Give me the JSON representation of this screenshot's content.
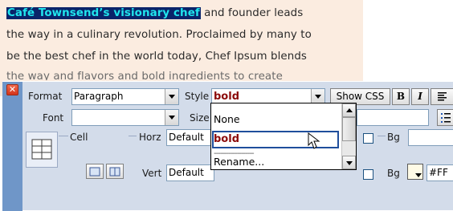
{
  "document": {
    "line1_selected": "Café Townsend’s visionary chef",
    "line1_rest": " and founder leads",
    "line2": "the way in a culinary revolution. Proclaimed by many to",
    "line3": "be the best chef in the world today, Chef Ipsum blends"
  },
  "inspector": {
    "close_icon": "close-icon",
    "format_label": "Format",
    "format_value": "Paragraph",
    "style_label": "Style",
    "style_value": "bold",
    "show_css_label": "Show CSS",
    "bold_label": "B",
    "italic_label": "I",
    "font_label": "Font",
    "font_value": "",
    "size_label": "Size",
    "cell_label": "Cell",
    "horz_label": "Horz",
    "horz_value": "Default",
    "vert_label": "Vert",
    "vert_value": "Default",
    "bg_label_1": "Bg",
    "bg_label_2": "Bg",
    "bg_color_value": "#FF",
    "style_menu": {
      "items": [
        "None",
        "bold",
        "-------------------",
        "Rename..."
      ],
      "selected": "bold"
    }
  },
  "colors": {
    "selection_bg": "#0a246a",
    "selection_text": "#20e6ee",
    "style_text": "#8b0a0a",
    "panel_bg": "#d3dcea",
    "panel_strip": "#6f96c8",
    "doc_bg": "#fbece0"
  }
}
